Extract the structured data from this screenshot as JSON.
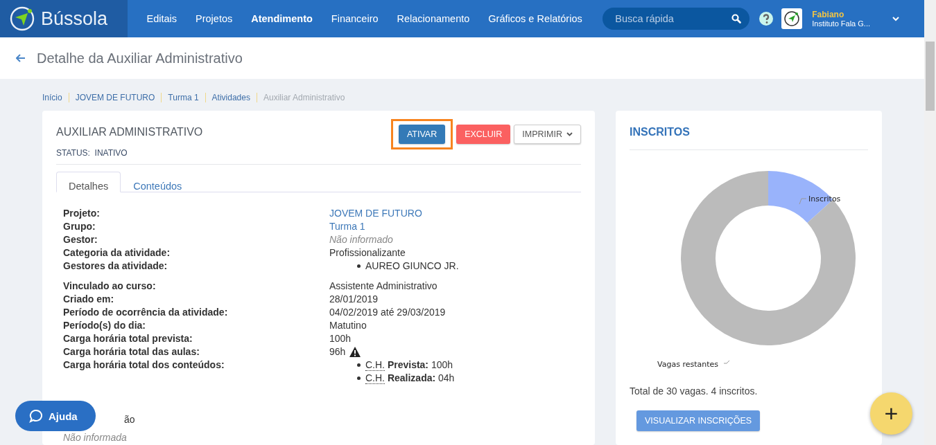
{
  "app": {
    "name": "Bússola"
  },
  "nav": [
    {
      "label": "Editais",
      "selected": false
    },
    {
      "label": "Projetos",
      "selected": false
    },
    {
      "label": "Atendimento",
      "selected": true
    },
    {
      "label": "Financeiro",
      "selected": false
    },
    {
      "label": "Relacionamento",
      "selected": false
    },
    {
      "label": "Gráficos e Relatórios",
      "selected": false
    }
  ],
  "search": {
    "placeholder": "Busca rápida"
  },
  "user": {
    "name": "Fabiano",
    "org": "Instituto Fala G..."
  },
  "page_title": "Detalhe da Auxiliar Administrativo",
  "breadcrumb": [
    {
      "label": "Início",
      "current": false
    },
    {
      "label": "JOVEM DE FUTURO",
      "current": false
    },
    {
      "label": "Turma 1",
      "current": false
    },
    {
      "label": "Atividades",
      "current": false
    },
    {
      "label": "Auxiliar Administrativo",
      "current": true
    }
  ],
  "activity": {
    "title": "AUXILIAR ADMINISTRATIVO",
    "status_label": "STATUS:",
    "status": "INATIVO"
  },
  "actions": [
    {
      "label": "ATIVAR",
      "kind": "primary",
      "highlighted": true
    },
    {
      "label": "EXCLUIR",
      "kind": "danger",
      "highlighted": false
    },
    {
      "label": "IMPRIMIR",
      "kind": "dropdown",
      "highlighted": false
    }
  ],
  "tabs": [
    {
      "label": "Detalhes",
      "selected": true
    },
    {
      "label": "Conteúdos",
      "selected": false
    }
  ],
  "detail_groups": [
    [
      {
        "label": "Projeto:",
        "kind": "link",
        "value": "JOVEM DE FUTURO"
      },
      {
        "label": "Grupo:",
        "kind": "link",
        "value": "Turma 1"
      },
      {
        "label": "Gestor:",
        "kind": "empty",
        "value": "Não informado"
      },
      {
        "label": "Categoria da atividade:",
        "kind": "text",
        "value": "Profissionalizante"
      },
      {
        "label": "Gestores da atividade:",
        "kind": "list",
        "items": [
          "AUREO GIUNCO JR."
        ]
      }
    ],
    [
      {
        "label": "Vinculado ao curso:",
        "kind": "text",
        "value": "Assistente Administrativo"
      },
      {
        "label": "Criado em:",
        "kind": "text",
        "value": "28/01/2019"
      },
      {
        "label": "Período de ocorrência da atividade:",
        "kind": "text",
        "value": "04/02/2019 até 29/03/2019"
      },
      {
        "label": "Período(s) do dia:",
        "kind": "text",
        "value": "Matutino"
      },
      {
        "label": "Carga horária total prevista:",
        "kind": "text",
        "value": "100h"
      },
      {
        "label": "Carga horária total das aulas:",
        "kind": "warning",
        "value": "96h"
      },
      {
        "label": "Carga horária total dos conteúdos:",
        "kind": "hours",
        "items": [
          {
            "abbr": "C.H.",
            "label": "Prevista:",
            "value": "100h"
          },
          {
            "abbr": "C.H.",
            "label": "Realizada:",
            "value": "04h"
          }
        ]
      }
    ]
  ],
  "description": {
    "label": "ão",
    "value": "Não informada"
  },
  "help_button": "Ajuda",
  "enrolled": {
    "title": "INSCRITOS",
    "chart_data": {
      "type": "donut",
      "categories": [
        "Inscritos",
        "Vagas restantes"
      ],
      "values": [
        13.3,
        86.7
      ],
      "colors": [
        "#99b3fb",
        "#bbbbbb"
      ]
    },
    "summary": "Total de 30 vagas. 4 inscritos.",
    "button": "VISUALIZAR INSCRIÇÕES"
  },
  "fab": "+"
}
